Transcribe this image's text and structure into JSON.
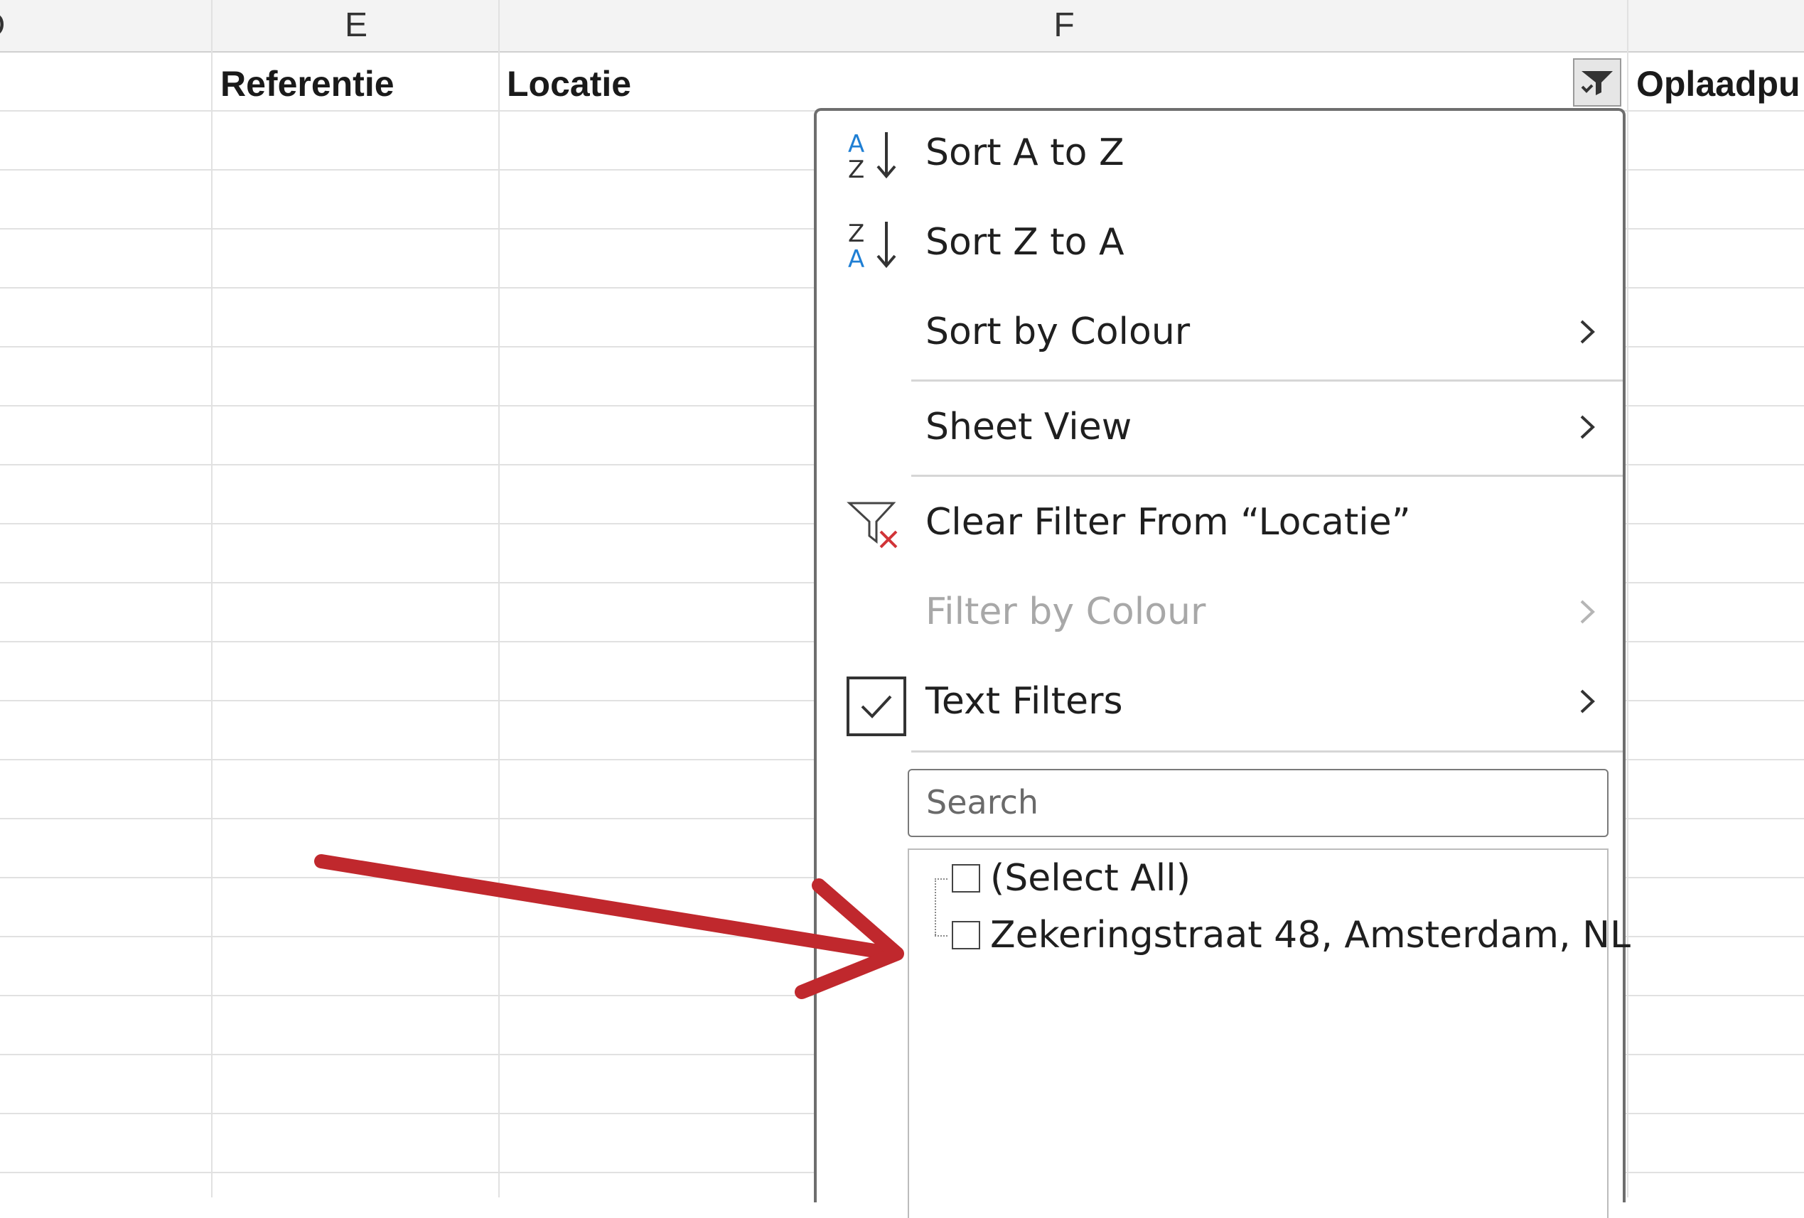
{
  "sheet": {
    "column_headers": [
      "D",
      "E",
      "F"
    ],
    "header_cells": {
      "referentie": "Referentie",
      "locatie": "Locatie",
      "oplaadpunt": "Oplaadpu"
    }
  },
  "filter_menu": {
    "sort_a_z": "Sort A to Z",
    "sort_z_a": "Sort Z to A",
    "sort_by_colour": "Sort by Colour",
    "sheet_view": "Sheet View",
    "clear_filter": "Clear Filter From “Locatie”",
    "filter_by_colour": "Filter by Colour",
    "text_filters": "Text Filters",
    "search_placeholder": "Search",
    "items": [
      "(Select All)",
      "Zekeringstraat 48, Amsterdam, NL"
    ]
  },
  "colors": {
    "annotation_arrow": "#c0282d",
    "sort_icon_blue": "#1f7fd4",
    "clear_x_red": "#d13438"
  }
}
